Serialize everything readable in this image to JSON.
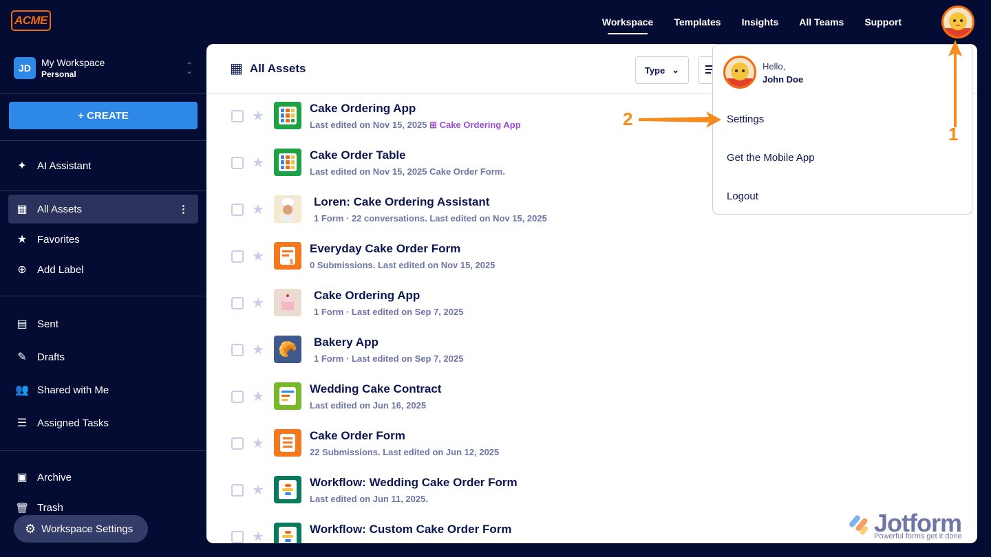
{
  "logo": "ACME",
  "topnav": [
    "Workspace",
    "Templates",
    "Insights",
    "All Teams",
    "Support"
  ],
  "workspace": {
    "initials": "JD",
    "name": "My Workspace",
    "type": "Personal"
  },
  "create_label": "+ CREATE",
  "sidebar": {
    "ai": "AI Assistant",
    "items": [
      "All Assets",
      "Favorites",
      "Add Label"
    ],
    "folders": [
      "Sent",
      "Drafts",
      "Shared with Me",
      "Assigned Tasks"
    ],
    "bottom": [
      "Archive",
      "Trash"
    ],
    "settings": "Workspace Settings"
  },
  "main": {
    "title": "All Assets",
    "type_filter": "Type",
    "assets": [
      {
        "name": "Cake Ordering App",
        "sub": "Last edited on Nov 15, 2025",
        "link": "Cake Ordering App",
        "icon": "table-app"
      },
      {
        "name": "Cake Order Table",
        "sub": "Last edited on Nov 15, 2025 Cake Order Form.",
        "icon": "table"
      },
      {
        "name": "Loren: Cake Ordering Assistant",
        "sub": "1 Form · 22 conversations. Last edited on Nov 15, 2025",
        "icon": "chef-photo"
      },
      {
        "name": "Everyday Cake Order Form",
        "sub": "0 Submissions. Last edited on Nov 15, 2025",
        "icon": "payment-form"
      },
      {
        "name": "Cake Ordering App",
        "sub": "1 Form · Last edited on Sep 7, 2025",
        "icon": "cake-photo"
      },
      {
        "name": "Bakery App",
        "sub": "1 Form · Last edited on Sep 7, 2025",
        "icon": "croissant"
      },
      {
        "name": "Wedding Cake Contract",
        "sub": "Last edited on Jun 16, 2025",
        "icon": "sign-document"
      },
      {
        "name": "Cake Order Form",
        "sub": "22 Submissions. Last edited on Jun 12, 2025",
        "icon": "form"
      },
      {
        "name": "Workflow: Wedding Cake Order Form",
        "sub": "Last edited on Jun 11, 2025.",
        "icon": "workflow"
      },
      {
        "name": "Workflow: Custom Cake Order Form",
        "sub": "",
        "icon": "workflow"
      }
    ]
  },
  "user_menu": {
    "hello": "Hello,",
    "name": "John Doe",
    "items": [
      "Settings",
      "Get the Mobile App",
      "Logout"
    ]
  },
  "annotations": [
    "1",
    "2"
  ],
  "watermark": {
    "brand": "Jotform",
    "tagline": "Powerful forms get it done"
  },
  "colors": {
    "background": "#050c33",
    "accent": "#2e88e8",
    "annotation": "#f58a1f",
    "link": "#9c4dd3"
  }
}
